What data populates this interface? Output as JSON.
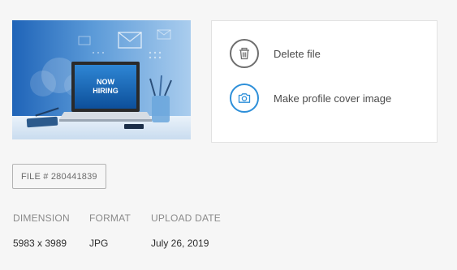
{
  "thumbnail": {
    "overlay_text_line1": "NOW",
    "overlay_text_line2": "HIRING"
  },
  "actions": [
    {
      "icon": "trash-icon",
      "label": "Delete file",
      "color": "#6e6e6e"
    },
    {
      "icon": "camera-icon",
      "label": "Make profile cover image",
      "color": "#2d8fd9"
    }
  ],
  "file_id": "FILE # 280441839",
  "meta": {
    "dimension": {
      "label": "DIMENSION",
      "value": "5983 x 3989"
    },
    "format": {
      "label": "FORMAT",
      "value": "JPG"
    },
    "upload_date": {
      "label": "UPLOAD DATE",
      "value": "July 26, 2019"
    }
  },
  "colors": {
    "page_background": "#f6f6f6",
    "accent_blue": "#2d8fd9"
  }
}
